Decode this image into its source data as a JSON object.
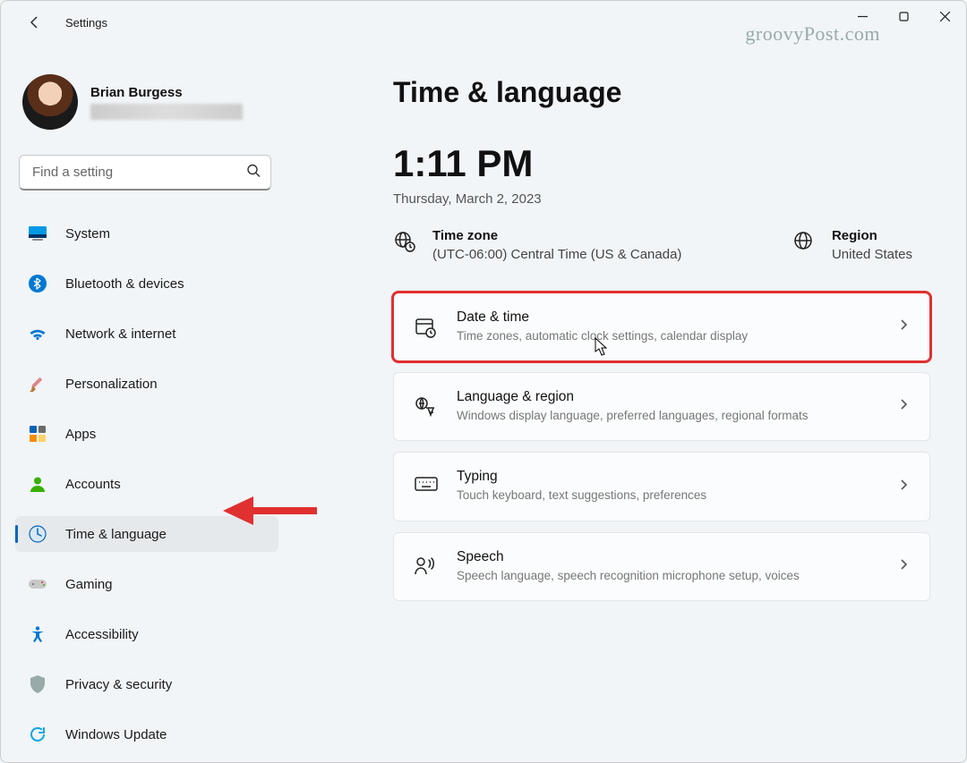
{
  "app": {
    "title": "Settings",
    "watermark": "groovyPost.com"
  },
  "profile": {
    "name": "Brian Burgess"
  },
  "search": {
    "placeholder": "Find a setting"
  },
  "sidebar": {
    "items": [
      {
        "label": "System"
      },
      {
        "label": "Bluetooth & devices"
      },
      {
        "label": "Network & internet"
      },
      {
        "label": "Personalization"
      },
      {
        "label": "Apps"
      },
      {
        "label": "Accounts"
      },
      {
        "label": "Time & language"
      },
      {
        "label": "Gaming"
      },
      {
        "label": "Accessibility"
      },
      {
        "label": "Privacy & security"
      },
      {
        "label": "Windows Update"
      }
    ]
  },
  "page": {
    "title": "Time & language",
    "time": "1:11 PM",
    "date": "Thursday, March 2, 2023",
    "timezone": {
      "label": "Time zone",
      "value": "(UTC-06:00) Central Time (US & Canada)"
    },
    "region": {
      "label": "Region",
      "value": "United States"
    },
    "cards": [
      {
        "title": "Date & time",
        "desc": "Time zones, automatic clock settings, calendar display"
      },
      {
        "title": "Language & region",
        "desc": "Windows display language, preferred languages, regional formats"
      },
      {
        "title": "Typing",
        "desc": "Touch keyboard, text suggestions, preferences"
      },
      {
        "title": "Speech",
        "desc": "Speech language, speech recognition microphone setup, voices"
      }
    ]
  }
}
